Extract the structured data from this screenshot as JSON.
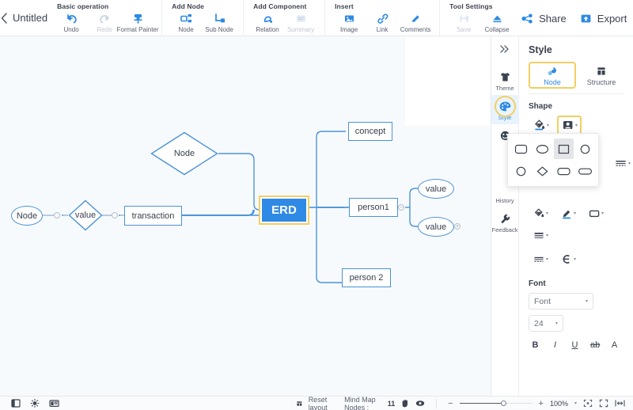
{
  "header": {
    "back_icon": "chevron-left-icon",
    "title": "Untitled",
    "groups": [
      {
        "label": "Basic operation",
        "items": [
          {
            "icon": "undo-icon",
            "label": "Undo",
            "disabled": false
          },
          {
            "icon": "redo-icon",
            "label": "Redo",
            "disabled": true
          },
          {
            "icon": "format-painter-icon",
            "label": "Format Painter",
            "disabled": false
          }
        ]
      },
      {
        "label": "Add Node",
        "items": [
          {
            "icon": "node-icon",
            "label": "Node",
            "disabled": false
          },
          {
            "icon": "sub-node-icon",
            "label": "Sub Node",
            "disabled": false
          }
        ]
      },
      {
        "label": "Add Component",
        "items": [
          {
            "icon": "relation-icon",
            "label": "Relation",
            "disabled": false
          },
          {
            "icon": "summary-icon",
            "label": "Summary",
            "disabled": true
          }
        ]
      },
      {
        "label": "Insert",
        "items": [
          {
            "icon": "image-icon",
            "label": "Image",
            "disabled": false
          },
          {
            "icon": "link-icon",
            "label": "Link",
            "disabled": false
          },
          {
            "icon": "comments-icon",
            "label": "Comments",
            "disabled": false
          }
        ]
      },
      {
        "label": "Tool Settings",
        "items": [
          {
            "icon": "save-icon",
            "label": "Save",
            "disabled": true
          },
          {
            "icon": "collapse-icon",
            "label": "Collapse",
            "disabled": false
          }
        ]
      }
    ],
    "share_label": "Share",
    "export_label": "Export"
  },
  "mindmap": {
    "root": {
      "label": "ERD",
      "shape": "rect",
      "fill": "#2e8ae4",
      "selected": true
    },
    "nodes": [
      {
        "id": "n1",
        "label": "Node",
        "shape": "ellipse"
      },
      {
        "id": "n2",
        "label": "value",
        "shape": "diamond"
      },
      {
        "id": "n3",
        "label": "transaction",
        "shape": "rect"
      },
      {
        "id": "n4",
        "label": "Node",
        "shape": "diamond"
      },
      {
        "id": "n5",
        "label": "concept",
        "shape": "rect"
      },
      {
        "id": "n6",
        "label": "person1",
        "shape": "rect"
      },
      {
        "id": "n7",
        "label": "value",
        "shape": "ellipse"
      },
      {
        "id": "n8",
        "label": "value",
        "shape": "ellipse"
      },
      {
        "id": "n9",
        "label": "person 2",
        "shape": "rect"
      }
    ],
    "handles": [
      {
        "id": "h1",
        "glyph": ""
      },
      {
        "id": "h2",
        "glyph": ""
      },
      {
        "id": "h3",
        "glyph": "−"
      },
      {
        "id": "h4",
        "glyph": "+"
      }
    ],
    "edge_color": "#4a93d9",
    "node_stroke": "#4a93d9"
  },
  "right_panel": {
    "rail": {
      "expand_icon": "chevron-double-right-icon",
      "items": [
        {
          "icon": "theme-shirt-icon",
          "label": "Theme",
          "active": false
        },
        {
          "icon": "style-palette-icon",
          "label": "Style",
          "active": true
        },
        {
          "icon": "emoji-icon",
          "label": "",
          "active": false
        }
      ],
      "bottom_items": [
        {
          "icon": "history-icon",
          "label": "History"
        },
        {
          "icon": "feedback-wrench-icon",
          "label": "Feedback"
        }
      ]
    },
    "title": "Style",
    "tabs": [
      {
        "icon": "node-style-icon",
        "label": "Node",
        "active": true
      },
      {
        "icon": "structure-icon",
        "label": "Structure",
        "active": false
      }
    ],
    "shape_section_label": "Shape",
    "shape_tools": [
      {
        "icon": "fill-bucket-icon",
        "selected": false
      },
      {
        "icon": "shape-picker-icon",
        "selected": true
      }
    ],
    "shape_popup": {
      "open": true,
      "shapes": [
        {
          "name": "rounded-rect-shape",
          "selected": false
        },
        {
          "name": "ellipse-shape",
          "selected": false
        },
        {
          "name": "rect-shape",
          "selected": true
        },
        {
          "name": "circle-shape",
          "selected": false
        },
        {
          "name": "circle-outline-shape",
          "selected": false
        },
        {
          "name": "diamond-shape",
          "selected": false
        },
        {
          "name": "stadium-shape",
          "selected": false
        },
        {
          "name": "pill-shape",
          "selected": false
        }
      ]
    },
    "style_tools_row1": [
      {
        "icon": "fill-bucket-icon"
      },
      {
        "icon": "pen-highlight-icon"
      },
      {
        "icon": "border-shape-icon"
      },
      {
        "icon": "line-weight-icon"
      }
    ],
    "style_tools_row2": [
      {
        "icon": "line-dash-icon"
      },
      {
        "icon": "branch-style-icon"
      }
    ],
    "line_type_tool": {
      "icon": "line-dash-icon"
    },
    "font": {
      "section_label": "Font",
      "family_value": "Font",
      "size_value": "24",
      "buttons": [
        {
          "name": "bold-button",
          "glyph": "B"
        },
        {
          "name": "italic-button",
          "glyph": "I"
        },
        {
          "name": "underline-button",
          "glyph": "U"
        },
        {
          "name": "strikethrough-button",
          "glyph": "ab"
        },
        {
          "name": "text-color-button",
          "glyph": "A"
        }
      ]
    }
  },
  "statusbar": {
    "left_icons": [
      "outline-view-icon",
      "brightness-icon",
      "presentation-icon"
    ],
    "reset_layout_label": "Reset layout",
    "nodes_label": "Mind Map Nodes :",
    "nodes_count": "11",
    "hand_tool_icon": "hand-icon",
    "focus_tool_icon": "eye-icon",
    "zoom_minus": "−",
    "zoom_plus": "+",
    "zoom_percent": "100%",
    "right_icons": [
      "fit-center-icon",
      "fullscreen-icon",
      "fit-width-icon"
    ]
  }
}
